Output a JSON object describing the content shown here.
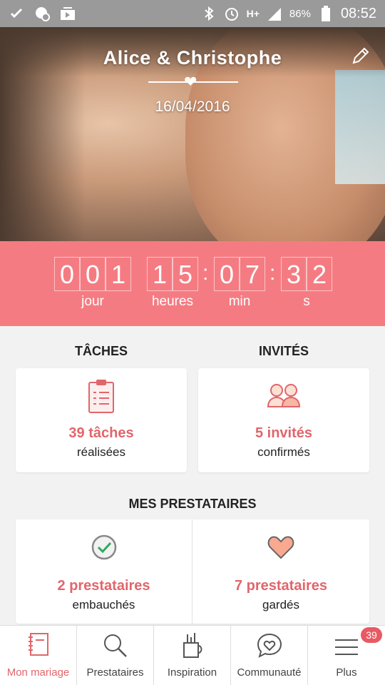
{
  "status_bar": {
    "network": "H+",
    "battery_percent": "86%",
    "time": "08:52"
  },
  "header": {
    "couple_names": "Alice & Christophe",
    "wedding_date": "16/04/2016"
  },
  "countdown": {
    "days": [
      "0",
      "0",
      "1"
    ],
    "hours": [
      "1",
      "5"
    ],
    "minutes": [
      "0",
      "7"
    ],
    "seconds": [
      "3",
      "2"
    ],
    "labels": {
      "days": "jour",
      "hours": "heures",
      "minutes": "min",
      "seconds": "s"
    }
  },
  "tasks": {
    "title": "TÂCHES",
    "count": "39 tâches",
    "subtitle": "réalisées"
  },
  "guests": {
    "title": "INVITÉS",
    "count": "5 invités",
    "subtitle": "confirmés"
  },
  "vendors": {
    "title": "MES PRESTATAIRES",
    "hired": {
      "count": "2 prestataires",
      "subtitle": "embauchés"
    },
    "saved": {
      "count": "7 prestataires",
      "subtitle": "gardés"
    }
  },
  "nav": {
    "items": [
      {
        "label": "Mon mariage",
        "icon": "notebook-icon",
        "active": true
      },
      {
        "label": "Prestataires",
        "icon": "search-icon"
      },
      {
        "label": "Inspiration",
        "icon": "brush-cup-icon"
      },
      {
        "label": "Communauté",
        "icon": "chat-heart-icon"
      },
      {
        "label": "Plus",
        "icon": "menu-icon",
        "badge": "39"
      }
    ]
  },
  "colors": {
    "accent": "#f57b82",
    "accent_text": "#e0666c",
    "status_bar": "#9a9a9a"
  }
}
